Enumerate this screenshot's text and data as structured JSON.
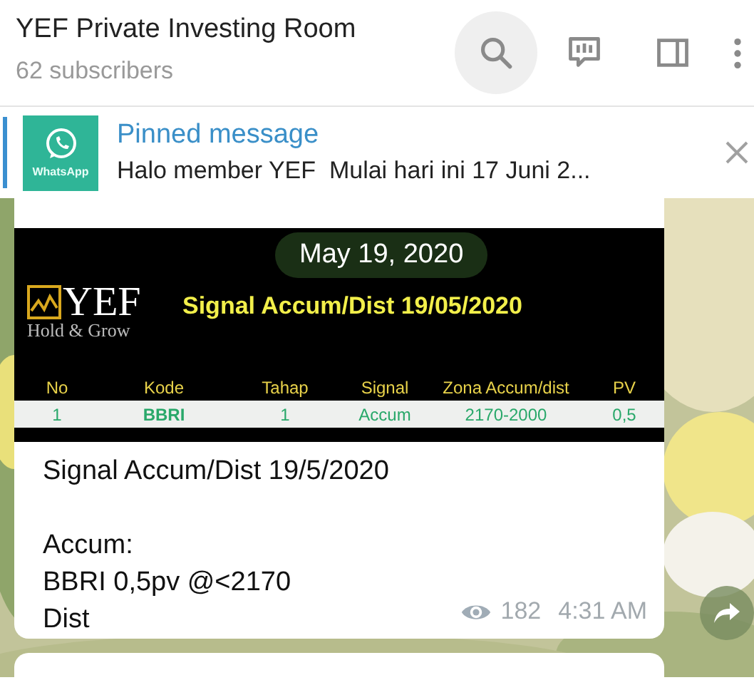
{
  "header": {
    "title": "YEF Private Investing Room",
    "subtitle": "62 subscribers"
  },
  "toolbar": [
    {
      "kind": "search",
      "highlighted": true
    },
    {
      "kind": "poll",
      "highlighted": false
    },
    {
      "kind": "sidebar",
      "highlighted": false
    },
    {
      "kind": "more",
      "highlighted": false
    }
  ],
  "pinned": {
    "thumbnail_caption": "WhatsApp",
    "label": "Pinned message",
    "text": "Halo member YEF  Mulai hari ini 17 Juni 2..."
  },
  "date_pill": "May 19, 2020",
  "message": {
    "image": {
      "logo_text": "YEF",
      "logo_tagline": "Hold & Grow",
      "title": "Signal Accum/Dist 19/05/2020",
      "columns": [
        "No",
        "Kode",
        "Tahap",
        "Signal",
        "Zona Accum/dist",
        "PV"
      ],
      "rows": [
        [
          "1",
          "BBRI",
          "1",
          "Accum",
          "2170-2000",
          "0,5"
        ]
      ]
    },
    "paragraphs": [
      [
        "Signal Accum/Dist 19/5/2020"
      ],
      [
        "Accum:",
        "BBRI 0,5pv @<2170",
        "Dist"
      ]
    ],
    "views": "182",
    "time": "4:31 AM"
  }
}
